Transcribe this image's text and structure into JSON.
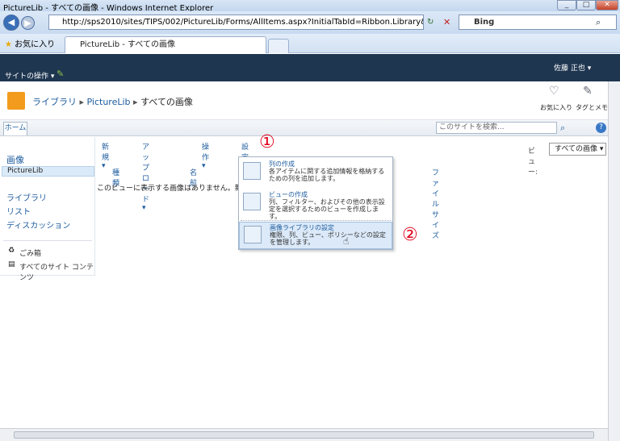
{
  "window": {
    "title": "PictureLib - すべての画像 - Windows Internet Explorer",
    "min": "_",
    "max": "□",
    "close": "✕"
  },
  "browser": {
    "address": "http://sps2010/sites/TIPS/002/PictureLib/Forms/AllItems.aspx?InitialTabId=Ribbon.Library&Visibi",
    "search_provider": "Bing",
    "favorites_label": "お気に入り",
    "tab_title": "PictureLib - すべての画像"
  },
  "sharepoint": {
    "site_actions": "サイトの操作 ▾",
    "user": "佐藤 正也 ▾",
    "breadcrumb": {
      "root": "ライブラリ",
      "sep1": "▸",
      "lib": "PictureLib",
      "sep2": "▸",
      "view": "すべての画像"
    },
    "social": {
      "like": "お気に入り",
      "tags": "タグとメモ"
    },
    "ribbon_home": "ホーム",
    "site_search_placeholder": "このサイトを検索...",
    "help": "?"
  },
  "leftnav": {
    "heading": "画像",
    "selected": "PictureLib",
    "items": [
      "ライブラリ",
      "リスト",
      "ディスカッション"
    ],
    "recycle": "ごみ箱",
    "all_content": "すべてのサイト コンテンツ"
  },
  "toolbar": {
    "new": "新規 ▾",
    "upload": "アップロード ▾",
    "actions": "操作 ▾",
    "settings": "設定 ▾",
    "view_label": "ビュー:",
    "view_value": "すべての画像 ▾"
  },
  "columns": [
    "種類",
    "名前",
    "ファイル サイズ"
  ],
  "empty_message": "このビューに表示する画像はありません。新しい画像",
  "settings_menu": [
    {
      "title": "列の作成",
      "desc": "各アイテムに関する追加情報を格納するための列を追加します。"
    },
    {
      "title": "ビューの作成",
      "desc": "列、フィルター、およびその他の表示設定を選択するためのビューを作成します。"
    },
    {
      "title": "画像ライブラリの設定",
      "desc": "権限、列、ビュー、ポリシーなどの設定を管理します。"
    }
  ],
  "callouts": {
    "one": "①",
    "two": "②"
  }
}
